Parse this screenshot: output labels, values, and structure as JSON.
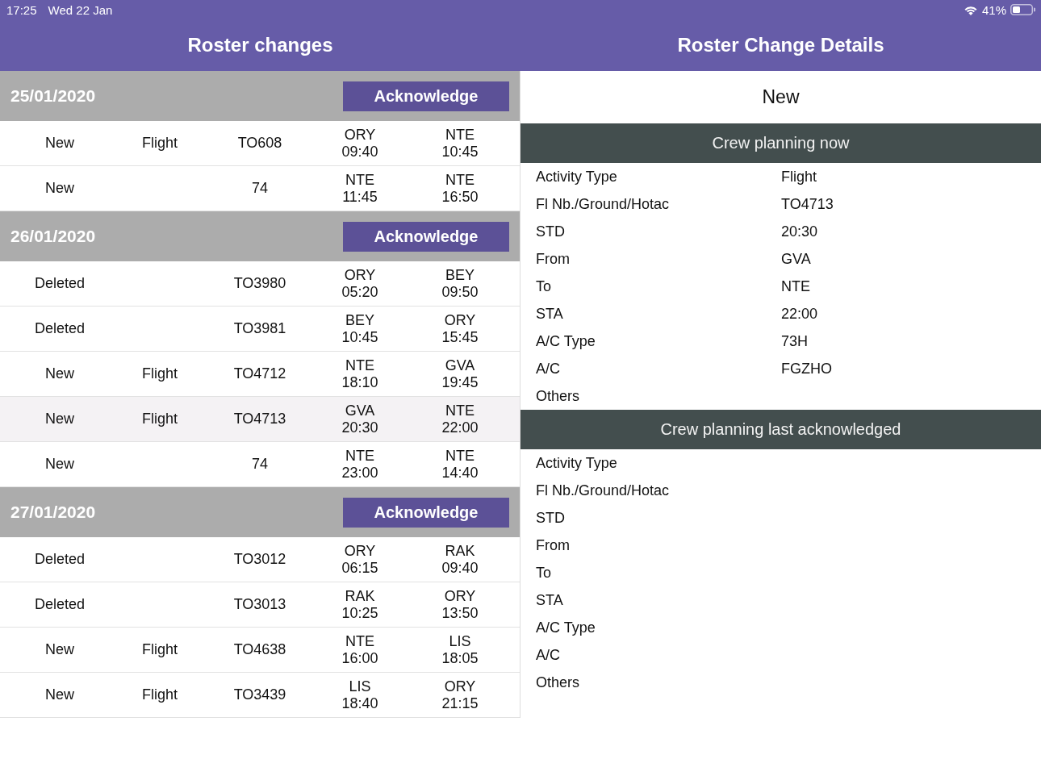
{
  "status_bar": {
    "time": "17:25",
    "date": "Wed 22 Jan",
    "battery": "41%"
  },
  "left_panel": {
    "title": "Roster changes",
    "groups": [
      {
        "date": "25/01/2020",
        "button": "Acknowledge",
        "rows": [
          {
            "selected": false,
            "change": "New",
            "activity": "Flight",
            "flight": "TO608",
            "from": "ORY",
            "departure": "09:40",
            "to": "NTE",
            "arrival": "10:45"
          },
          {
            "selected": false,
            "change": "New",
            "flight": "74",
            "from": "NTE",
            "departure": "11:45",
            "to": "NTE",
            "arrival": "16:50"
          }
        ]
      },
      {
        "date": "26/01/2020",
        "button": "Acknowledge",
        "rows": [
          {
            "selected": false,
            "change": "Deleted",
            "flight": "TO3980",
            "from": "ORY",
            "departure": "05:20",
            "to": "BEY",
            "arrival": "09:50"
          },
          {
            "selected": false,
            "change": "Deleted",
            "flight": "TO3981",
            "from": "BEY",
            "departure": "10:45",
            "to": "ORY",
            "arrival": "15:45"
          },
          {
            "selected": false,
            "change": "New",
            "activity": "Flight",
            "flight": "TO4712",
            "from": "NTE",
            "departure": "18:10",
            "to": "GVA",
            "arrival": "19:45"
          },
          {
            "selected": true,
            "change": "New",
            "activity": "Flight",
            "flight": "TO4713",
            "from": "GVA",
            "departure": "20:30",
            "to": "NTE",
            "arrival": "22:00"
          },
          {
            "selected": false,
            "change": "New",
            "flight": "74",
            "from": "NTE",
            "departure": "23:00",
            "to": "NTE",
            "arrival": "14:40"
          }
        ]
      },
      {
        "date": "27/01/2020",
        "button": "Acknowledge",
        "rows": [
          {
            "selected": false,
            "change": "Deleted",
            "flight": "TO3012",
            "from": "ORY",
            "departure": "06:15",
            "to": "RAK",
            "arrival": "09:40"
          },
          {
            "selected": false,
            "change": "Deleted",
            "flight": "TO3013",
            "from": "RAK",
            "departure": "10:25",
            "to": "ORY",
            "arrival": "13:50"
          },
          {
            "selected": false,
            "change": "New",
            "activity": "Flight",
            "flight": "TO4638",
            "from": "NTE",
            "departure": "16:00",
            "to": "LIS",
            "arrival": "18:05"
          },
          {
            "selected": false,
            "change": "New",
            "activity": "Flight",
            "flight": "TO3439",
            "from": "LIS",
            "departure": "18:40",
            "to": "ORY",
            "arrival": "21:15"
          }
        ]
      }
    ]
  },
  "right_panel": {
    "title": "Roster Change Details",
    "status": "New",
    "sections": [
      {
        "title": "Crew planning now",
        "fields": [
          {
            "label": "Activity Type",
            "value": "Flight"
          },
          {
            "label": "Fl Nb./Ground/Hotac",
            "value": "TO4713"
          },
          {
            "label": "STD",
            "value": "20:30"
          },
          {
            "label": "From",
            "value": "GVA"
          },
          {
            "label": "To",
            "value": "NTE"
          },
          {
            "label": "STA",
            "value": "22:00"
          },
          {
            "label": "A/C Type",
            "value": "73H"
          },
          {
            "label": "A/C",
            "value": "FGZHO"
          },
          {
            "label": "Others"
          }
        ]
      },
      {
        "title": "Crew planning last acknowledged",
        "fields": [
          {
            "label": "Activity Type"
          },
          {
            "label": "Fl Nb./Ground/Hotac"
          },
          {
            "label": "STD"
          },
          {
            "label": "From"
          },
          {
            "label": "To"
          },
          {
            "label": "STA"
          },
          {
            "label": "A/C Type"
          },
          {
            "label": "A/C"
          },
          {
            "label": "Others"
          }
        ]
      }
    ]
  }
}
